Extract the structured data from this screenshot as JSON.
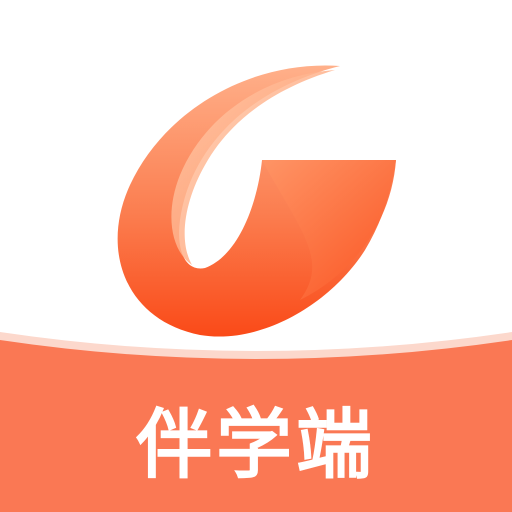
{
  "app_icon": {
    "label": "伴学端",
    "logo_icon": "swoosh-g-logo-icon",
    "colors": {
      "background": "#ffffff",
      "banner": "#fa7854",
      "banner_highlight": "#fcd8cc",
      "logo_light": "#ffb08a",
      "logo_mid": "#fb7d4f",
      "logo_dark": "#fa4a18",
      "label_text": "#ffffff"
    }
  }
}
